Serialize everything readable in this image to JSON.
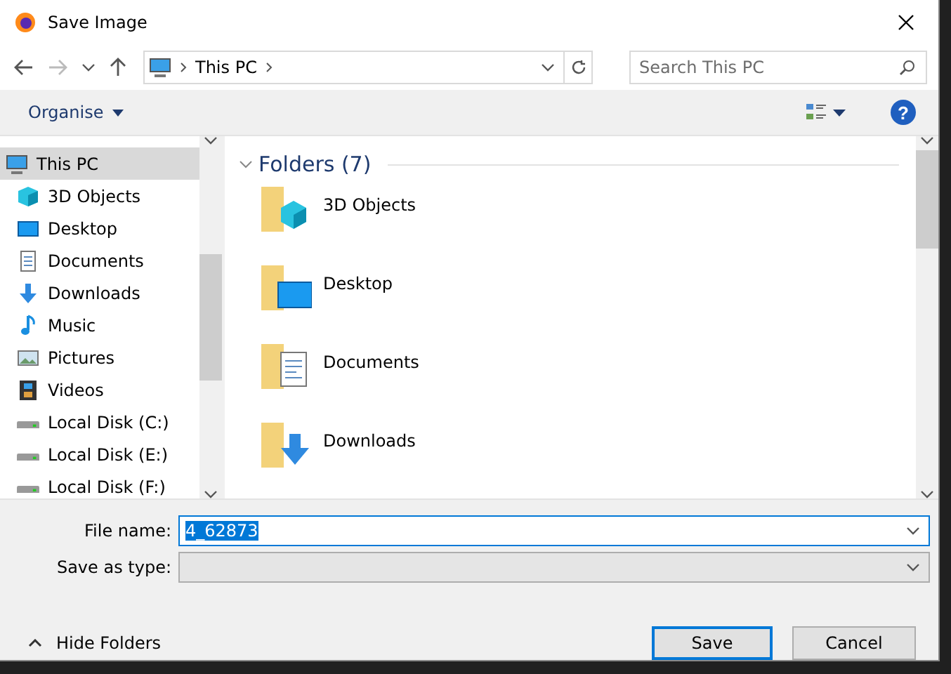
{
  "window": {
    "title": "Save Image"
  },
  "address_bar": {
    "path": [
      "This PC"
    ]
  },
  "search": {
    "placeholder": "Search This PC"
  },
  "toolbar": {
    "organise": "Organise",
    "help": "?"
  },
  "sidebar": {
    "items": [
      {
        "label": "This PC",
        "kind": "pc",
        "selected": true,
        "children": [
          {
            "label": "3D Objects",
            "kind": "cube",
            "selected": false
          },
          {
            "label": "Desktop",
            "kind": "desktop",
            "selected": false
          },
          {
            "label": "Documents",
            "kind": "documents",
            "selected": false
          },
          {
            "label": "Downloads",
            "kind": "downloads",
            "selected": false
          },
          {
            "label": "Music",
            "kind": "music",
            "selected": false
          },
          {
            "label": "Pictures",
            "kind": "pictures",
            "selected": false
          },
          {
            "label": "Videos",
            "kind": "videos",
            "selected": false
          },
          {
            "label": "Local Disk (C:)",
            "kind": "disk",
            "selected": false
          },
          {
            "label": "Local Disk (E:)",
            "kind": "disk",
            "selected": false
          },
          {
            "label": "Local Disk (F:)",
            "kind": "disk",
            "selected": false
          }
        ]
      }
    ]
  },
  "content": {
    "group": {
      "title": "Folders (7)",
      "expanded": true
    },
    "folders": [
      {
        "name": "3D Objects",
        "kind": "cube"
      },
      {
        "name": "Desktop",
        "kind": "desktop"
      },
      {
        "name": "Documents",
        "kind": "documents"
      },
      {
        "name": "Downloads",
        "kind": "downloads"
      }
    ]
  },
  "form": {
    "file_name": {
      "label": "File name:",
      "value": "4_62873",
      "selected": true
    },
    "save_as_type": {
      "label": "Save as type:"
    }
  },
  "hide_folders": "Hide Folders",
  "buttons": [
    {
      "label": "Save",
      "kind": "primary"
    },
    {
      "label": "Cancel",
      "kind": "secondary"
    }
  ]
}
